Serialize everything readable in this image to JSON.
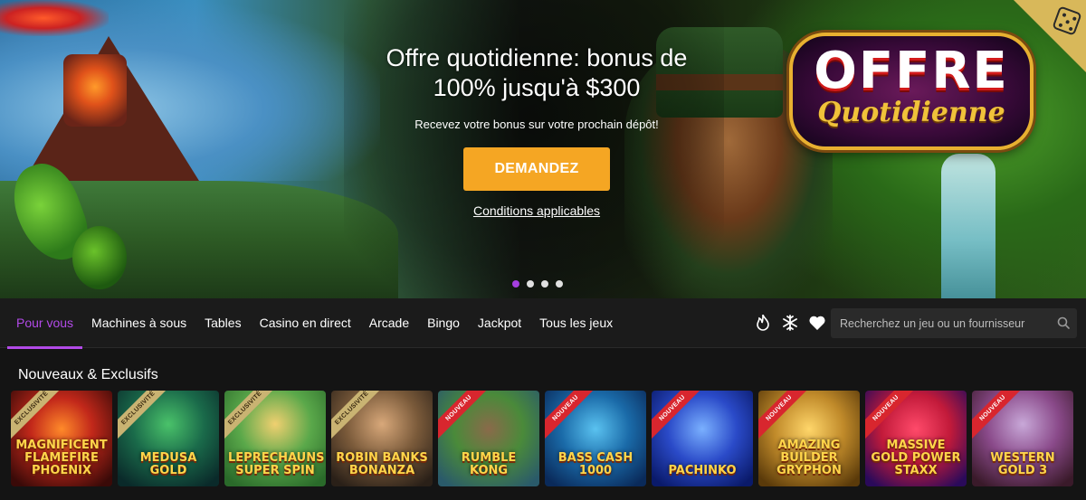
{
  "hero": {
    "title": "Offre quotidienne: bonus de 100% jusqu'à $300",
    "subtitle": "Recevez votre bonus sur votre prochain dépôt!",
    "cta_label": "DEMANDEZ",
    "terms_label": "Conditions applicables",
    "logo_line1": "OFFRE",
    "logo_line2": "Quotidienne",
    "slides_count": 4,
    "active_slide": 1,
    "cta_color": "#f5a623"
  },
  "nav": {
    "tabs": [
      {
        "label": "Pour vous",
        "active": true
      },
      {
        "label": "Machines à sous"
      },
      {
        "label": "Tables"
      },
      {
        "label": "Casino en direct"
      },
      {
        "label": "Arcade"
      },
      {
        "label": "Bingo"
      },
      {
        "label": "Jackpot"
      },
      {
        "label": "Tous les jeux"
      }
    ],
    "icons": [
      "fire-icon",
      "snowflake-icon",
      "heart-icon"
    ],
    "search_placeholder": "Recherchez un jeu ou un fournisseur",
    "accent_color": "#b24ae8"
  },
  "section": {
    "title": "Nouveaux & Exclusifs"
  },
  "games": [
    {
      "title": "MAGNIFICENT FLAMEFIRE PHOENIX",
      "badge": "EXCLUSIVITÉ"
    },
    {
      "title": "MEDUSA GOLD",
      "badge": "EXCLUSIVITÉ"
    },
    {
      "title": "LEPRECHAUNS SUPER SPIN",
      "badge": "EXCLUSIVITÉ"
    },
    {
      "title": "ROBIN BANKS BONANZA",
      "badge": "EXCLUSIVITÉ"
    },
    {
      "title": "RUMBLE KONG",
      "badge": "NOUVEAU"
    },
    {
      "title": "BASS CASH 1000",
      "badge": "NOUVEAU"
    },
    {
      "title": "PACHINKO",
      "badge": "NOUVEAU"
    },
    {
      "title": "AMAZING BUILDER GRYPHON",
      "badge": "NOUVEAU"
    },
    {
      "title": "MASSIVE GOLD POWER STAXX",
      "badge": "NOUVEAU"
    },
    {
      "title": "WESTERN GOLD 3",
      "badge": "NOUVEAU"
    }
  ]
}
